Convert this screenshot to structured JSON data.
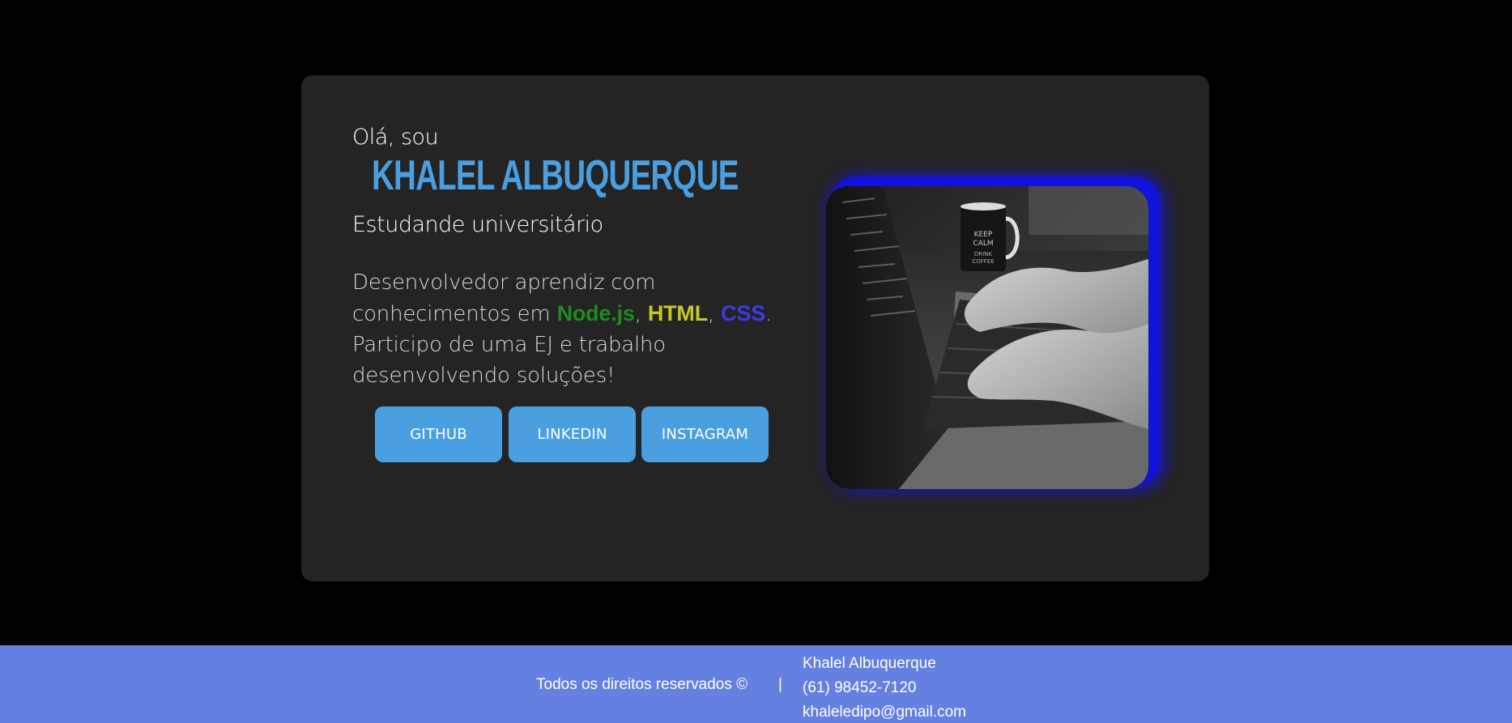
{
  "hero": {
    "greeting": "Olá, sou",
    "name": "KHALEL ALBUQUERQUE",
    "subtitle": "Estudande universitário",
    "description": {
      "intro": "Desenvolvedor aprendiz com conhecimentos em ",
      "tech": [
        {
          "label": "Node.js",
          "color": "#1f8a1f"
        },
        {
          "label": "HTML",
          "color": "#c8c823"
        },
        {
          "label": "CSS",
          "color": "#3b3be8"
        }
      ],
      "sep1": ", ",
      "sep2": ", ",
      "outro": ". Participo de uma EJ e trabalho desenvolvendo soluções!"
    }
  },
  "buttons": {
    "github": "GITHUB",
    "linkedin": "LINKEDIN",
    "instagram": "INSTAGRAM"
  },
  "photo": {
    "mug_text_1": "KEEP",
    "mug_text_2": "CALM",
    "mug_text_3": "DRINK",
    "mug_text_4": "COFFEE"
  },
  "footer": {
    "rights": "Todos os direitos reservados ©",
    "separator": "|",
    "name": "Khalel Albuquerque",
    "phone": "(61) 98452-7120",
    "email": "khaleledipo@gmail.com"
  },
  "colors": {
    "accent": "#4a9fe0",
    "card": "#242424",
    "footer": "#6480e0",
    "glow": "#1212d8"
  }
}
